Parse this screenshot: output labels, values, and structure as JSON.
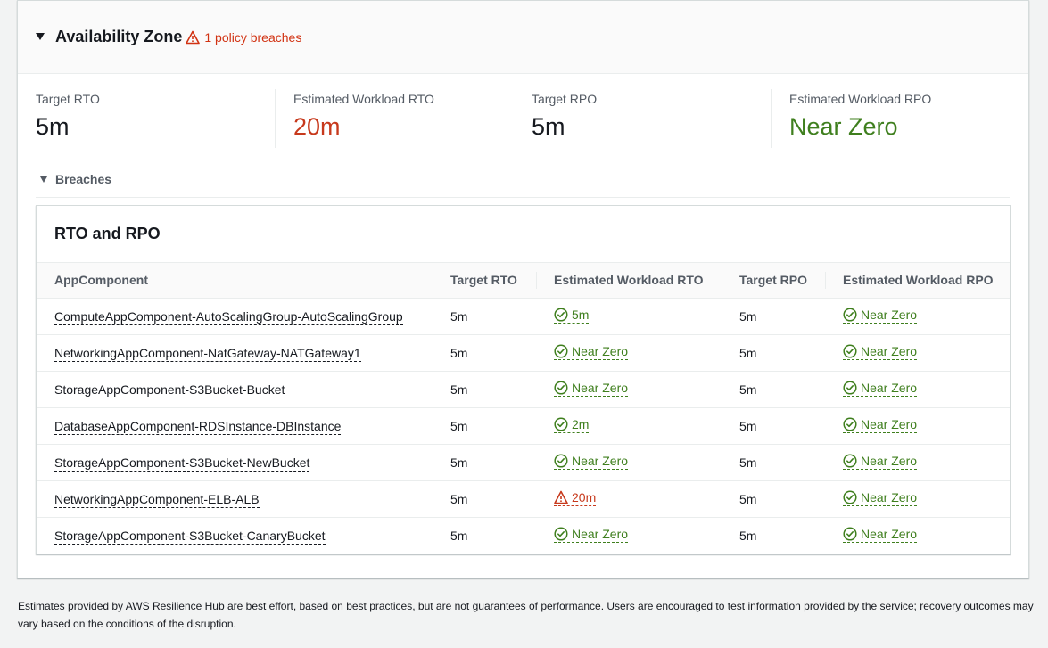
{
  "section": {
    "title": "Availability Zone",
    "breach_text": "1 policy breaches"
  },
  "metrics": [
    {
      "label": "Target RTO",
      "value": "5m",
      "color": "#16191f"
    },
    {
      "label": "Estimated Workload RTO",
      "value": "20m",
      "color": "#c7391c"
    },
    {
      "label": "Target RPO",
      "value": "5m",
      "color": "#16191f"
    },
    {
      "label": "Estimated Workload RPO",
      "value": "Near Zero",
      "color": "#3f7f1e"
    }
  ],
  "breaches": {
    "label": "Breaches",
    "table_title": "RTO and RPO",
    "columns": [
      "AppComponent",
      "Target RTO",
      "Estimated Workload RTO",
      "Target RPO",
      "Estimated Workload RPO"
    ],
    "rows": [
      {
        "component": "ComputeAppComponent-AutoScalingGroup-AutoScalingGroup",
        "target_rto": "5m",
        "est_rto": "5m",
        "est_rto_status": "ok",
        "target_rpo": "5m",
        "est_rpo": "Near Zero",
        "est_rpo_status": "ok"
      },
      {
        "component": "NetworkingAppComponent-NatGateway-NATGateway1",
        "target_rto": "5m",
        "est_rto": "Near Zero",
        "est_rto_status": "ok",
        "target_rpo": "5m",
        "est_rpo": "Near Zero",
        "est_rpo_status": "ok"
      },
      {
        "component": "StorageAppComponent-S3Bucket-Bucket",
        "target_rto": "5m",
        "est_rto": "Near Zero",
        "est_rto_status": "ok",
        "target_rpo": "5m",
        "est_rpo": "Near Zero",
        "est_rpo_status": "ok"
      },
      {
        "component": "DatabaseAppComponent-RDSInstance-DBInstance",
        "target_rto": "5m",
        "est_rto": "2m",
        "est_rto_status": "ok",
        "target_rpo": "5m",
        "est_rpo": "Near Zero",
        "est_rpo_status": "ok"
      },
      {
        "component": "StorageAppComponent-S3Bucket-NewBucket",
        "target_rto": "5m",
        "est_rto": "Near Zero",
        "est_rto_status": "ok",
        "target_rpo": "5m",
        "est_rpo": "Near Zero",
        "est_rpo_status": "ok"
      },
      {
        "component": "NetworkingAppComponent-ELB-ALB",
        "target_rto": "5m",
        "est_rto": "20m",
        "est_rto_status": "breach",
        "target_rpo": "5m",
        "est_rpo": "Near Zero",
        "est_rpo_status": "ok"
      },
      {
        "component": "StorageAppComponent-S3Bucket-CanaryBucket",
        "target_rto": "5m",
        "est_rto": "Near Zero",
        "est_rto_status": "ok",
        "target_rpo": "5m",
        "est_rpo": "Near Zero",
        "est_rpo_status": "ok"
      }
    ]
  },
  "footer": {
    "disclaimer": "Estimates provided by AWS Resilience Hub are best effort, based on best practices, but are not guarantees of performance. Users are encouraged to test information provided by the service; recovery outcomes may vary based on the conditions of the disruption."
  },
  "colors": {
    "ok": "#3f7f1e",
    "breach": "#c7391c",
    "text": "#16191f",
    "muted": "#545b64"
  },
  "icons": {
    "ok": "check-circle-icon",
    "breach": "warning-triangle-icon"
  }
}
